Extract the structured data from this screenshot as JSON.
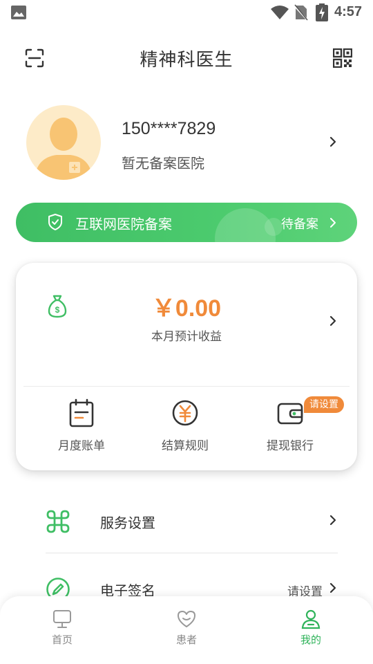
{
  "status_bar": {
    "time": "4:57",
    "icons": [
      "image-icon",
      "wifi-icon",
      "no-sim-icon",
      "battery-charging-icon"
    ]
  },
  "header": {
    "title": "精神科医生",
    "left_icon": "scan-icon",
    "right_icon": "qr-code-icon"
  },
  "profile": {
    "phone": "150****7829",
    "hospital": "暂无备案医院"
  },
  "banner": {
    "label": "互联网医院备案",
    "status": "待备案",
    "icon": "shield-check-icon"
  },
  "earnings": {
    "amount": "￥0.00",
    "label": "本月预计收益",
    "icon": "money-bag-icon",
    "actions": [
      {
        "label": "月度账单",
        "icon": "bill-icon"
      },
      {
        "label": "结算规则",
        "icon": "yuan-circle-icon"
      },
      {
        "label": "提现银行",
        "icon": "wallet-icon",
        "badge": "请设置"
      }
    ]
  },
  "menu": [
    {
      "label": "服务设置",
      "icon": "command-icon",
      "value": ""
    },
    {
      "label": "电子签名",
      "icon": "pen-icon",
      "value": "请设置"
    }
  ],
  "bottom_nav": [
    {
      "label": "首页",
      "icon": "monitor-icon",
      "active": false
    },
    {
      "label": "患者",
      "icon": "heart-icon",
      "active": false
    },
    {
      "label": "我的",
      "icon": "user-icon",
      "active": true
    }
  ],
  "colors": {
    "primary_green": "#3FBE64",
    "accent_orange": "#F08A3A",
    "avatar_bg": "#FDEBC8",
    "text_dark": "#333333"
  }
}
